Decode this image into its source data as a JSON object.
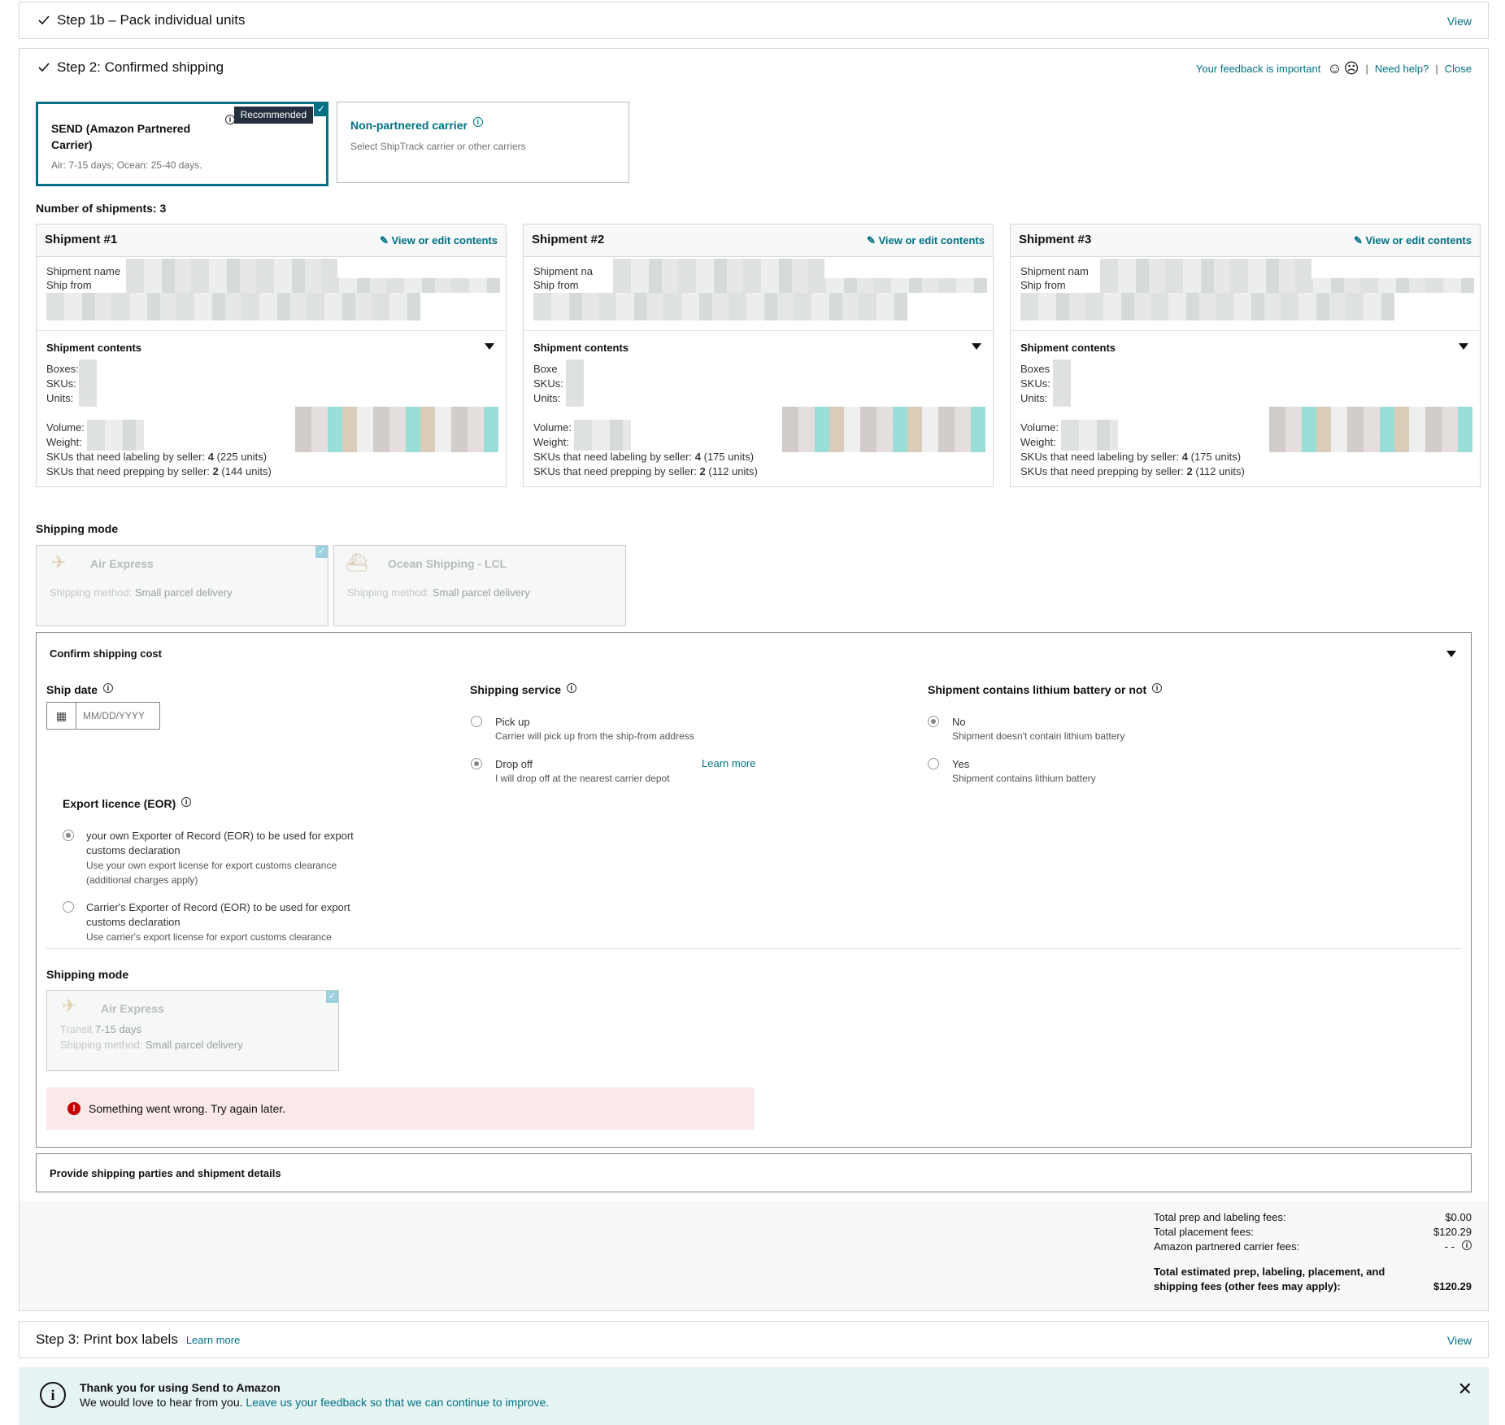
{
  "step1b": {
    "title": "Step 1b – Pack individual units",
    "view": "View"
  },
  "step2": {
    "title": "Step 2: Confirmed shipping",
    "feedback": "Your feedback is important",
    "need_help": "Need help?",
    "close": "Close",
    "sep": "|"
  },
  "carriers": {
    "send": {
      "title": "SEND (Amazon Partnered Carrier)",
      "badge": "Recommended",
      "sub": "Air: 7-15 days; Ocean: 25-40 days."
    },
    "non": {
      "title": "Non-partnered carrier",
      "sub": "Select ShipTrack carrier or other carriers"
    }
  },
  "num_shipments": "Number of shipments: 3",
  "shipments": [
    {
      "title": "Shipment #1",
      "edit": "View or edit contents",
      "name_label": "Shipment name",
      "from_label": "Ship from",
      "contents": "Shipment contents",
      "boxes": "Boxes:",
      "skus": "SKUs:",
      "units": "Units:",
      "volume": "Volume:",
      "weight": "Weight:",
      "labeling_label": "SKUs that need labeling by seller:",
      "labeling_value": "4",
      "labeling_units": "(225 units)",
      "prepping_label": "SKUs that need prepping by seller:",
      "prepping_value": "2",
      "prepping_units": "(144 units)"
    },
    {
      "title": "Shipment #2",
      "edit": "View or edit contents",
      "name_label": "Shipment na",
      "from_label": "Ship from",
      "contents": "Shipment contents",
      "boxes": "Boxe",
      "skus": "SKUs:",
      "units": "Units:",
      "volume": "Volume:",
      "weight": "Weight:",
      "labeling_label": "SKUs that need labeling by seller:",
      "labeling_value": "4",
      "labeling_units": "(175 units)",
      "prepping_label": "SKUs that need prepping by seller:",
      "prepping_value": "2",
      "prepping_units": "(112 units)"
    },
    {
      "title": "Shipment #3",
      "edit": "View or edit contents",
      "name_label": "Shipment nam",
      "from_label": "Ship from",
      "contents": "Shipment contents",
      "boxes": "Boxes",
      "skus": "SKUs:",
      "units": "Units:",
      "volume": "Volume:",
      "weight": "Weight:",
      "labeling_label": "SKUs that need labeling by seller:",
      "labeling_value": "4",
      "labeling_units": "(175 units)",
      "prepping_label": "SKUs that need prepping by seller:",
      "prepping_value": "2",
      "prepping_units": "(112 units)"
    }
  ],
  "shipping_mode": {
    "label": "Shipping mode",
    "air": {
      "title": "Air Express",
      "method_label": "Shipping method:",
      "method": "Small parcel delivery"
    },
    "ocean": {
      "title": "Ocean Shipping - LCL",
      "method_label": "Shipping method:",
      "method": "Small parcel delivery"
    }
  },
  "confirm": {
    "title": "Confirm shipping cost",
    "ship_date": {
      "label": "Ship date",
      "placeholder": "MM/DD/YYYY"
    },
    "service": {
      "label": "Shipping service",
      "pickup": "Pick up",
      "pickup_sub": "Carrier will pick up from the ship-from address",
      "dropoff": "Drop off",
      "dropoff_sub": "I will drop off at the nearest carrier depot",
      "learn_more": "Learn more"
    },
    "lithium": {
      "label": "Shipment contains lithium battery or not",
      "no": "No",
      "no_sub": "Shipment doesn't contain lithium battery",
      "yes": "Yes",
      "yes_sub": "Shipment contains lithium battery"
    },
    "eor": {
      "label": "Export licence (EOR)",
      "own": "your own Exporter of Record (EOR) to be used for export customs declaration",
      "own_sub": "Use your own export license for export customs clearance (additional charges apply)",
      "carrier": "Carrier's Exporter of Record (EOR) to be used for export customs declaration",
      "carrier_sub": "Use carrier's export license for export customs clearance"
    },
    "mode": {
      "label": "Shipping mode",
      "title": "Air Express",
      "transit_label": "Transit",
      "transit": "7-15 days",
      "method_label": "Shipping method:",
      "method": "Small parcel delivery"
    },
    "error": "Something went wrong. Try again later."
  },
  "parties": {
    "title": "Provide shipping parties and shipment details"
  },
  "fees": {
    "prep_label": "Total prep and labeling fees:",
    "prep_value": "$0.00",
    "placement_label": "Total placement fees:",
    "placement_value": "$120.29",
    "carrier_label": "Amazon partnered carrier fees:",
    "carrier_value": "- -",
    "total_label": "Total estimated prep, labeling, placement, and shipping fees (other fees may apply):",
    "total_value": "$120.29"
  },
  "step3": {
    "title": "Step 3: Print box labels",
    "learn_more": "Learn more",
    "view": "View"
  },
  "banner": {
    "title": "Thank you for using Send to Amazon",
    "text": "We would love to hear from you.",
    "link": "Leave us your feedback so that we can continue to improve."
  }
}
